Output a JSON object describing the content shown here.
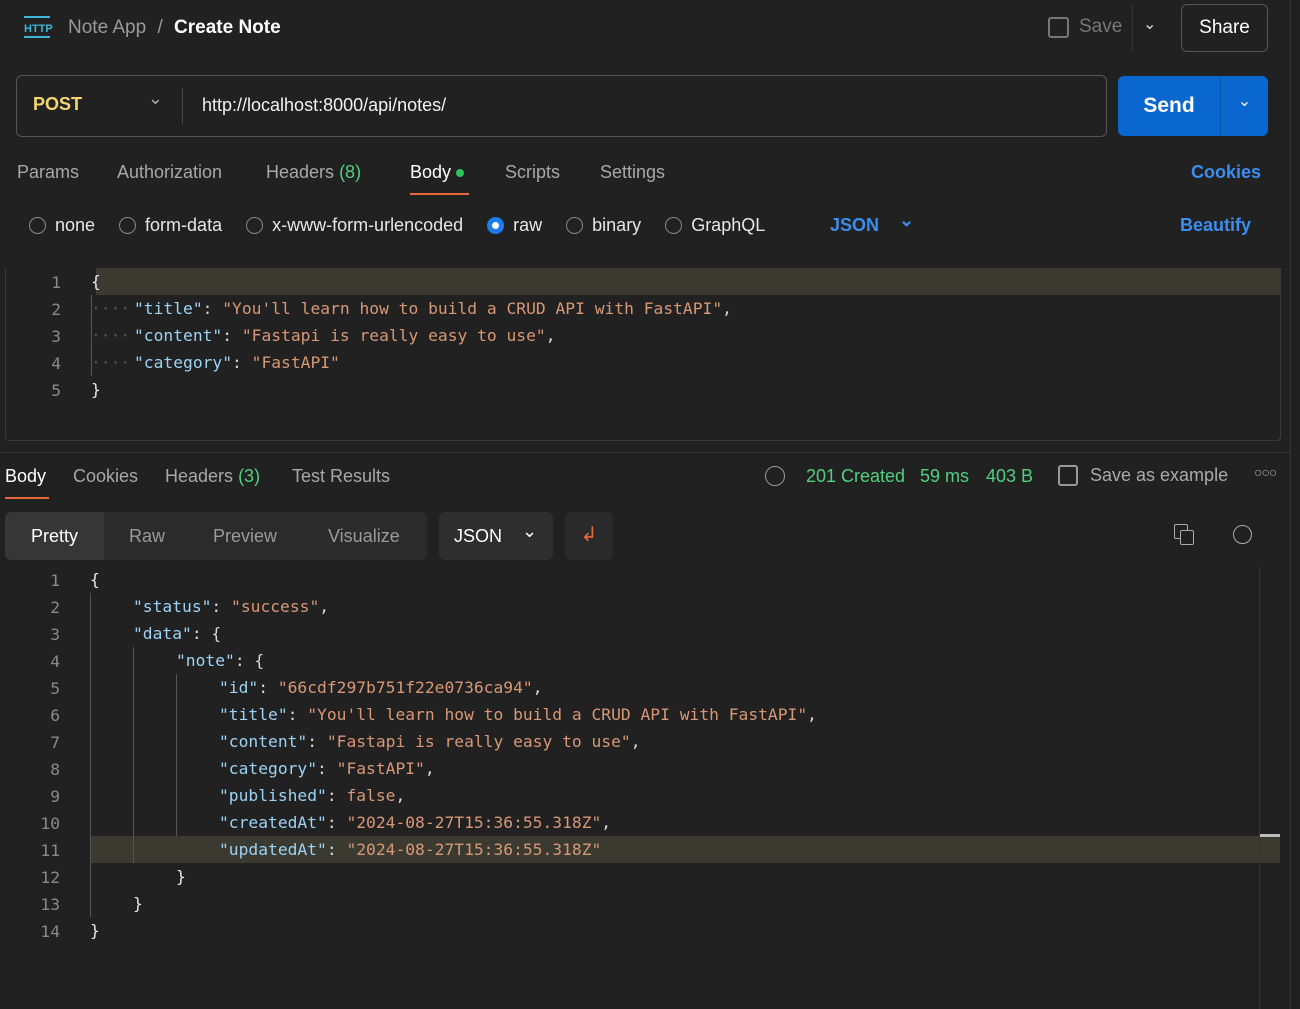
{
  "header": {
    "breadcrumb_parent": "Note App",
    "separator": "/",
    "title": "Create Note",
    "save_label": "Save",
    "share_label": "Share",
    "icon": "http-icon"
  },
  "request": {
    "method": "POST",
    "url": "http://localhost:8000/api/notes/",
    "send_label": "Send"
  },
  "req_tabs": {
    "params": "Params",
    "authorization": "Authorization",
    "headers": "Headers",
    "headers_count": "(8)",
    "body": "Body",
    "scripts": "Scripts",
    "settings": "Settings",
    "cookies": "Cookies"
  },
  "body_types": {
    "options": [
      "none",
      "form-data",
      "x-www-form-urlencoded",
      "raw",
      "binary",
      "GraphQL"
    ],
    "selected": "raw",
    "format": "JSON",
    "beautify": "Beautify"
  },
  "request_body": [
    {
      "n": "1",
      "indent": 0,
      "parts": [
        {
          "t": "{",
          "c": "b"
        }
      ]
    },
    {
      "n": "2",
      "indent": 1,
      "parts": [
        {
          "t": "\"title\"",
          "c": "k"
        },
        {
          "t": ": ",
          "c": "p"
        },
        {
          "t": "\"You'll learn how to build a CRUD API with FastAPI\"",
          "c": "s"
        },
        {
          "t": ",",
          "c": "p"
        }
      ]
    },
    {
      "n": "3",
      "indent": 1,
      "parts": [
        {
          "t": "\"content\"",
          "c": "k"
        },
        {
          "t": ": ",
          "c": "p"
        },
        {
          "t": "\"Fastapi is really easy to use\"",
          "c": "s"
        },
        {
          "t": ",",
          "c": "p"
        }
      ]
    },
    {
      "n": "4",
      "indent": 1,
      "parts": [
        {
          "t": "\"category\"",
          "c": "k"
        },
        {
          "t": ": ",
          "c": "p"
        },
        {
          "t": "\"FastAPI\"",
          "c": "s"
        }
      ]
    },
    {
      "n": "5",
      "indent": 0,
      "parts": [
        {
          "t": "}",
          "c": "b"
        }
      ]
    }
  ],
  "resp_tabs": {
    "body": "Body",
    "cookies": "Cookies",
    "headers": "Headers",
    "headers_count": "(3)",
    "tests": "Test Results"
  },
  "status": {
    "code": "201 Created",
    "time": "59 ms",
    "size": "403 B",
    "save_example": "Save as example",
    "color": "#4fd17f"
  },
  "view_modes": {
    "pretty": "Pretty",
    "raw": "Raw",
    "preview": "Preview",
    "visualize": "Visualize",
    "format": "JSON"
  },
  "response_body": [
    {
      "n": "1",
      "indent": 0,
      "parts": [
        {
          "t": "{",
          "c": "b"
        }
      ]
    },
    {
      "n": "2",
      "indent": 1,
      "parts": [
        {
          "t": "\"status\"",
          "c": "k"
        },
        {
          "t": ": ",
          "c": "p"
        },
        {
          "t": "\"success\"",
          "c": "s"
        },
        {
          "t": ",",
          "c": "p"
        }
      ]
    },
    {
      "n": "3",
      "indent": 1,
      "parts": [
        {
          "t": "\"data\"",
          "c": "k"
        },
        {
          "t": ": {",
          "c": "p"
        }
      ]
    },
    {
      "n": "4",
      "indent": 2,
      "parts": [
        {
          "t": "\"note\"",
          "c": "k"
        },
        {
          "t": ": {",
          "c": "p"
        }
      ]
    },
    {
      "n": "5",
      "indent": 3,
      "parts": [
        {
          "t": "\"id\"",
          "c": "k"
        },
        {
          "t": ": ",
          "c": "p"
        },
        {
          "t": "\"66cdf297b751f22e0736ca94\"",
          "c": "s"
        },
        {
          "t": ",",
          "c": "p"
        }
      ]
    },
    {
      "n": "6",
      "indent": 3,
      "parts": [
        {
          "t": "\"title\"",
          "c": "k"
        },
        {
          "t": ": ",
          "c": "p"
        },
        {
          "t": "\"You'll learn how to build a CRUD API with FastAPI\"",
          "c": "s"
        },
        {
          "t": ",",
          "c": "p"
        }
      ]
    },
    {
      "n": "7",
      "indent": 3,
      "parts": [
        {
          "t": "\"content\"",
          "c": "k"
        },
        {
          "t": ": ",
          "c": "p"
        },
        {
          "t": "\"Fastapi is really easy to use\"",
          "c": "s"
        },
        {
          "t": ",",
          "c": "p"
        }
      ]
    },
    {
      "n": "8",
      "indent": 3,
      "parts": [
        {
          "t": "\"category\"",
          "c": "k"
        },
        {
          "t": ": ",
          "c": "p"
        },
        {
          "t": "\"FastAPI\"",
          "c": "s"
        },
        {
          "t": ",",
          "c": "p"
        }
      ]
    },
    {
      "n": "9",
      "indent": 3,
      "parts": [
        {
          "t": "\"published\"",
          "c": "k"
        },
        {
          "t": ": ",
          "c": "p"
        },
        {
          "t": "false",
          "c": "s"
        },
        {
          "t": ",",
          "c": "p"
        }
      ]
    },
    {
      "n": "10",
      "indent": 3,
      "parts": [
        {
          "t": "\"createdAt\"",
          "c": "k"
        },
        {
          "t": ": ",
          "c": "p"
        },
        {
          "t": "\"2024-08-27T15:36:55.318Z\"",
          "c": "s"
        },
        {
          "t": ",",
          "c": "p"
        }
      ]
    },
    {
      "n": "11",
      "indent": 3,
      "parts": [
        {
          "t": "\"updatedAt\"",
          "c": "k"
        },
        {
          "t": ": ",
          "c": "p"
        },
        {
          "t": "\"2024-08-27T15:36:55.318Z\"",
          "c": "s"
        }
      ]
    },
    {
      "n": "12",
      "indent": 2,
      "parts": [
        {
          "t": "}",
          "c": "b"
        }
      ]
    },
    {
      "n": "13",
      "indent": 1,
      "parts": [
        {
          "t": "}",
          "c": "b"
        }
      ]
    },
    {
      "n": "14",
      "indent": 0,
      "parts": [
        {
          "t": "}",
          "c": "b"
        }
      ]
    }
  ],
  "colors": {
    "accent": "#1b6fd6",
    "method": "#f5d76e",
    "tab_underline": "#e8683c",
    "link": "#3b8ef0"
  }
}
